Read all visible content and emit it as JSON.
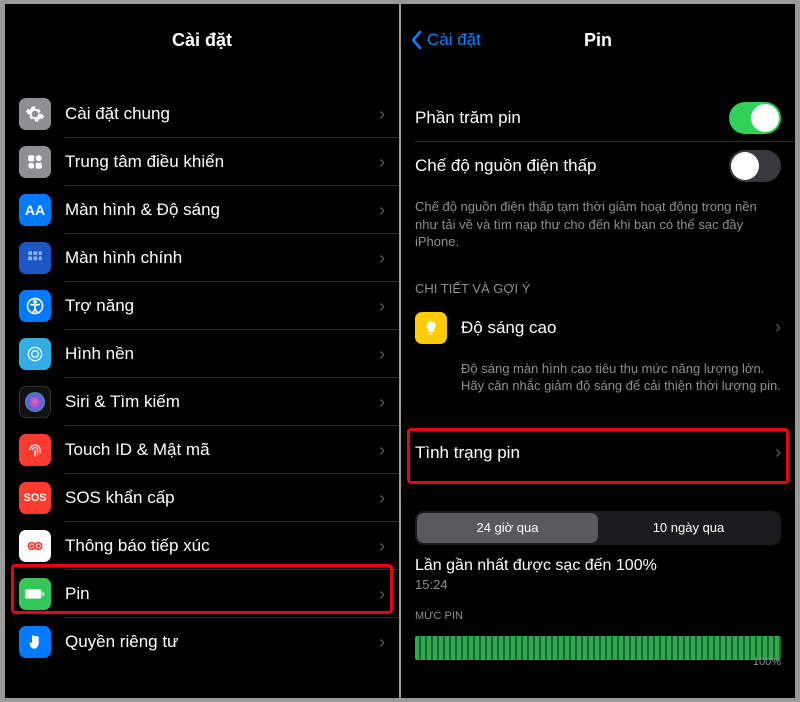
{
  "left": {
    "title": "Cài đặt",
    "items": [
      {
        "label": "Cài đặt chung"
      },
      {
        "label": "Trung tâm điều khiển"
      },
      {
        "label": "Màn hình & Độ sáng"
      },
      {
        "label": "Màn hình chính"
      },
      {
        "label": "Trợ năng"
      },
      {
        "label": "Hình nền"
      },
      {
        "label": "Siri & Tìm kiếm"
      },
      {
        "label": "Touch ID & Mật mã"
      },
      {
        "label": "SOS khẩn cấp"
      },
      {
        "label": "Thông báo tiếp xúc"
      },
      {
        "label": "Pin"
      },
      {
        "label": "Quyền riêng tư"
      }
    ]
  },
  "right": {
    "back": "Cài đặt",
    "title": "Pin",
    "percent_label": "Phần trăm pin",
    "lowpower_label": "Chế độ nguồn điện thấp",
    "lowpower_desc": "Chế độ nguồn điện thấp tạm thời giảm hoạt động trong nền như tải về và tìm nạp thư cho đến khi bạn có thể sạc đầy iPhone.",
    "insights_header": "CHI TIẾT VÀ GỢI Ý",
    "brightness_label": "Độ sáng cao",
    "brightness_desc": "Độ sáng màn hình cao tiêu thụ mức năng lượng lớn. Hãy cân nhắc giảm độ sáng để cải thiện thời lượng pin.",
    "health_label": "Tình trạng pin",
    "seg24": "24 giờ qua",
    "seg10": "10 ngày qua",
    "last_charge_label": "Lần gần nhất được sạc đến 100%",
    "last_charge_time": "15:24",
    "chart_header": "MỨC PIN",
    "chart_100": "100%"
  }
}
